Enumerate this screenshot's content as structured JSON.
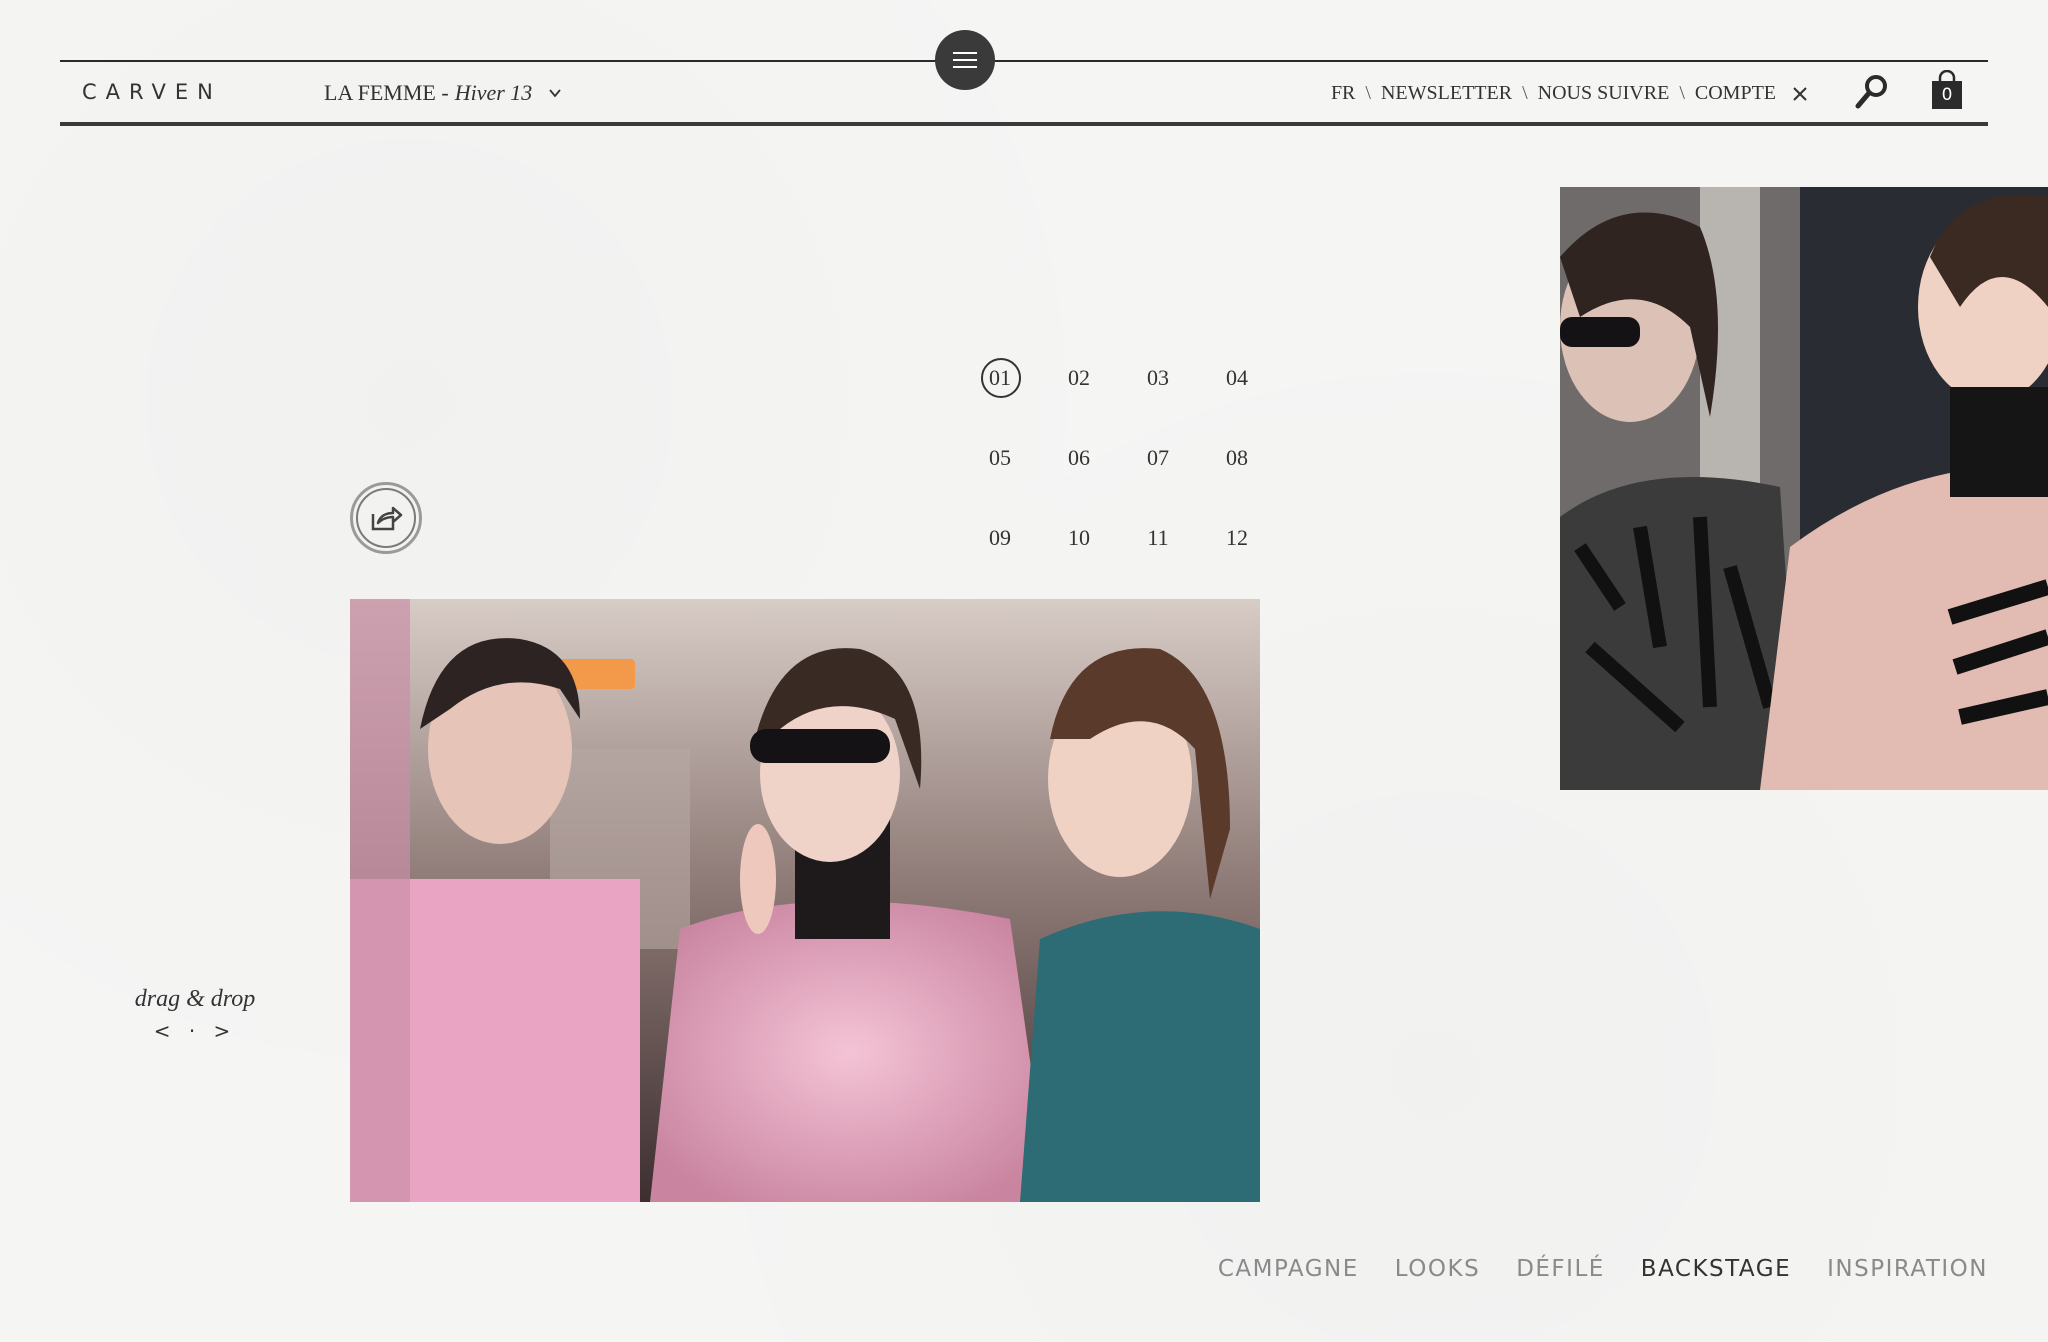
{
  "header": {
    "logo": "CARVEN",
    "collection_label": "LA FEMME -",
    "collection_season": "Hiver 13",
    "nav": {
      "lang": "FR",
      "newsletter": "NEWSLETTER",
      "follow": "NOUS SUIVRE",
      "account": "COMPTE",
      "separator": "\\"
    },
    "cart_count": "0"
  },
  "gallery": {
    "pages": [
      "01",
      "02",
      "03",
      "04",
      "05",
      "06",
      "07",
      "08",
      "09",
      "10",
      "11",
      "12"
    ],
    "active_page": "01"
  },
  "drag_hint": {
    "label": "drag & drop",
    "arrows": "< · >"
  },
  "bottom_nav": {
    "items": [
      "CAMPAGNE",
      "LOOKS",
      "DÉFILÉ",
      "BACKSTAGE",
      "INSPIRATION"
    ],
    "active": "BACKSTAGE"
  },
  "icons": {
    "menu": "hamburger-icon",
    "search": "search-icon",
    "cart": "shopping-bag-icon",
    "share": "share-icon",
    "close": "close-icon",
    "dropdown": "chevron-down-icon"
  }
}
